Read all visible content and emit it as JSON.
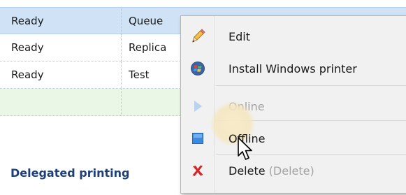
{
  "table": {
    "rows": [
      {
        "status": "Ready",
        "name": "Queue"
      },
      {
        "status": "Ready",
        "name": "Replica"
      },
      {
        "status": "Ready",
        "name": "Test"
      },
      {
        "status": "",
        "name": ""
      }
    ]
  },
  "section": {
    "title": "Delegated printing"
  },
  "context_menu": {
    "items": [
      {
        "label": "Edit",
        "icon": "pencil-icon",
        "enabled": true
      },
      {
        "label": "Install Windows printer",
        "icon": "windows-logo-icon",
        "enabled": true
      },
      {
        "label": "Online",
        "icon": "play-arrow-icon",
        "enabled": false
      },
      {
        "label": "Offline",
        "icon": "blue-square-icon",
        "enabled": true,
        "hovered": true
      },
      {
        "label": "Delete",
        "shortcut": "(Delete)",
        "icon": "red-x-icon",
        "enabled": true
      }
    ]
  },
  "colors": {
    "selected_row": "#cfe2f6",
    "new_row": "#eaf7e6",
    "section_title": "#1f3f78",
    "menu_bg": "#f1f1f1",
    "disabled_text": "#a3a3a3"
  }
}
